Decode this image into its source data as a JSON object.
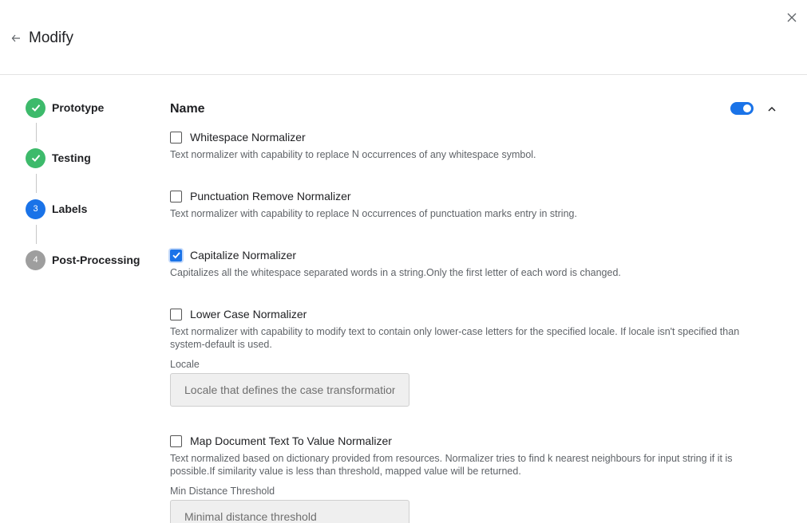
{
  "header": {
    "title": "Modify"
  },
  "stepper": {
    "steps": [
      {
        "label": "Prototype",
        "status": "done",
        "number": ""
      },
      {
        "label": "Testing",
        "status": "done",
        "number": ""
      },
      {
        "label": "Labels",
        "status": "active",
        "number": "3"
      },
      {
        "label": "Post-Processing",
        "status": "todo",
        "number": "4"
      }
    ]
  },
  "section": {
    "title": "Name",
    "enabled": true
  },
  "options": [
    {
      "label": "Whitespace Normalizer",
      "checked": false,
      "description": "Text normalizer with capability to replace N occurrences of any whitespace symbol."
    },
    {
      "label": "Punctuation Remove Normalizer",
      "checked": false,
      "description": "Text normalizer with capability to replace N occurrences of punctuation marks entry in string."
    },
    {
      "label": "Capitalize Normalizer",
      "checked": true,
      "description": "Capitalizes all the whitespace separated words in a string.Only the first letter of each word is changed."
    },
    {
      "label": "Lower Case Normalizer",
      "checked": false,
      "description": "Text normalizer with capability to modify text to contain only lower-case letters for the specified locale. If locale isn't specified than system-default is used.",
      "field": {
        "label": "Locale",
        "placeholder": "Locale that defines the case transformation rules"
      }
    },
    {
      "label": "Map Document Text To Value Normalizer",
      "checked": false,
      "description": "Text normalized based on dictionary provided from resources. Normalizer tries to find k nearest neighbours for input string if it is possible.If similarity value is less than threshold, mapped value will be returned.",
      "field": {
        "label": "Min Distance Threshold",
        "placeholder": "Minimal distance threshold"
      }
    }
  ],
  "colors": {
    "accent": "#1a73e8",
    "done": "#3dba6b",
    "todo": "#9e9e9e"
  }
}
